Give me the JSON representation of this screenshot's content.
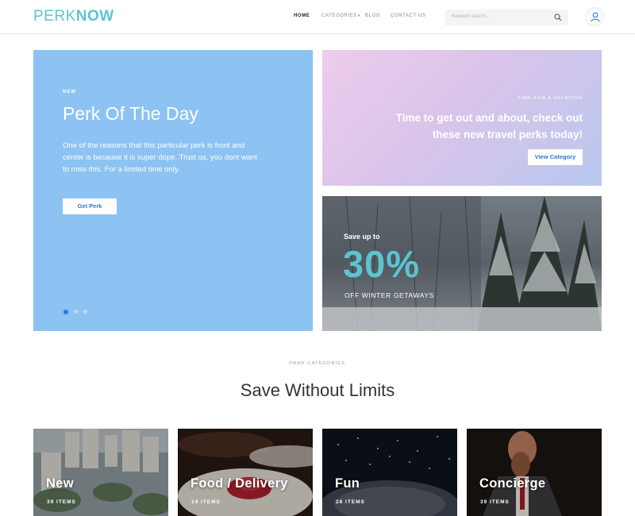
{
  "brand": {
    "part1": "PERK",
    "part2": "NOW"
  },
  "nav": {
    "items": [
      {
        "label": "HOME"
      },
      {
        "label": "CATEGORIES"
      },
      {
        "label": "BLOG"
      },
      {
        "label": "CONTACT US"
      }
    ]
  },
  "search": {
    "placeholder": "Keyword search..."
  },
  "hero": {
    "tag": "NEW",
    "title": "Perk Of The Day",
    "description": "One of the reasons that this particular perk is front and center is because it is super dope.  Trust us, you dont want to miss this.  For a limited time only.",
    "button": "Get Perk"
  },
  "vacation": {
    "tag": "TIME FOR A VACATION",
    "title": "Time to get out and about, check out these new travel perks today!",
    "button": "View Category"
  },
  "winter": {
    "small": "Save up to",
    "big": "30%",
    "sub": "OFF WINTER GETAWAYS"
  },
  "section": {
    "tag": "PERK CATEGORIES",
    "title": "Save Without Limits"
  },
  "categories": [
    {
      "name": "New",
      "count": "39 ITEMS"
    },
    {
      "name": "Food / Delivery",
      "count": "14 ITEMS"
    },
    {
      "name": "Fun",
      "count": "28 ITEMS"
    },
    {
      "name": "Concierge",
      "count": "39 ITEMS"
    }
  ],
  "colors": {
    "accent": "#5cc4cf",
    "hero": "#8cc3f2",
    "link": "#2d7ad6"
  }
}
